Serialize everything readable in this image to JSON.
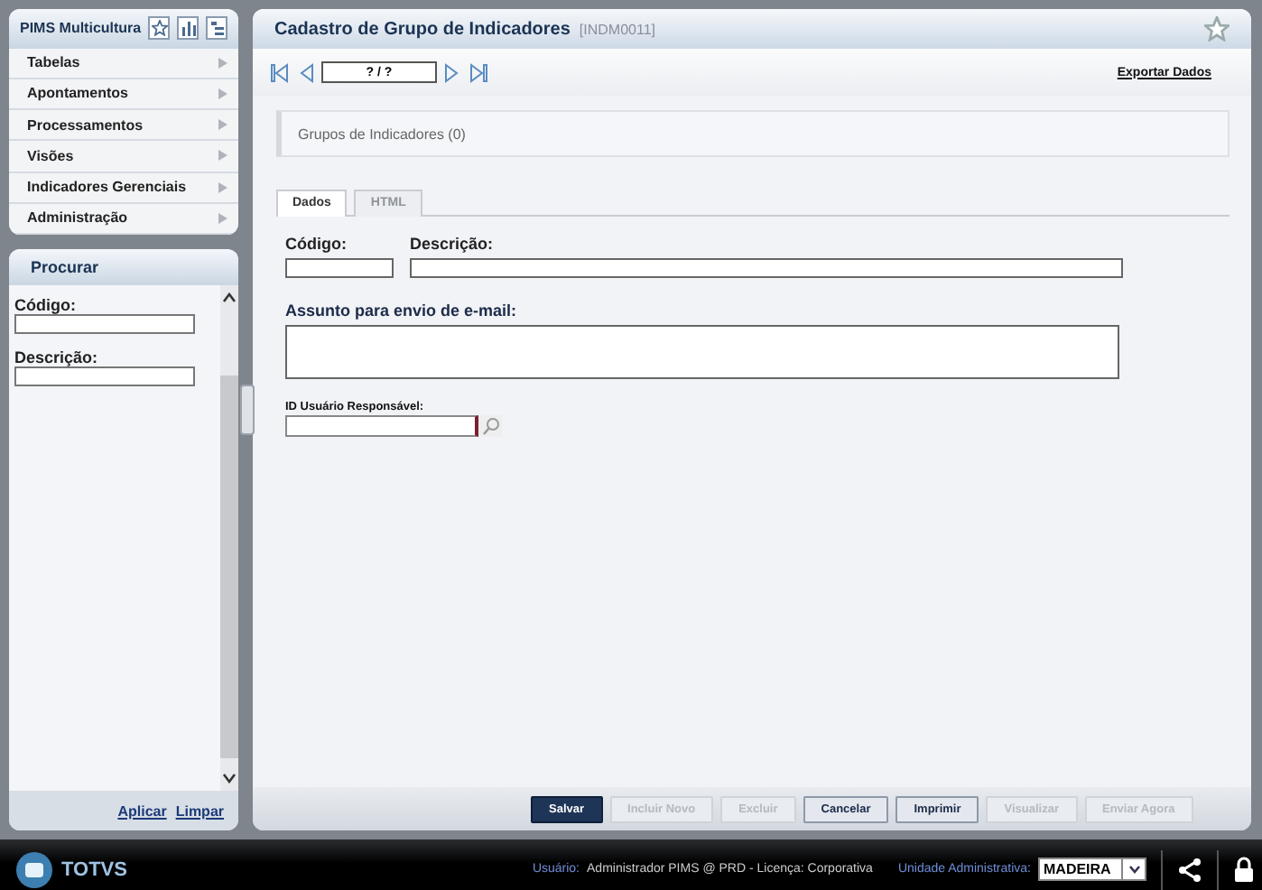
{
  "app_title": "PIMS Multicultura",
  "menu": [
    {
      "label": "Tabelas"
    },
    {
      "label": "Apontamentos"
    },
    {
      "label": "Processamentos"
    },
    {
      "label": "Visões"
    },
    {
      "label": "Indicadores Gerenciais"
    },
    {
      "label": "Administração"
    }
  ],
  "search_panel": {
    "title": "Procurar",
    "fields": [
      {
        "label": "Código:"
      },
      {
        "label": "Descrição:"
      }
    ],
    "links": [
      "Aplicar",
      "Limpar"
    ]
  },
  "window": {
    "title": "Cadastro de Grupo de Indicadores",
    "code": "[INDM0011]"
  },
  "navigator": {
    "position": "? / ?",
    "export_link": "Exportar Dados"
  },
  "group_header": "Grupos de Indicadores (0)",
  "tabs": [
    {
      "label": "Dados",
      "selected": true,
      "disabled": false
    },
    {
      "label": "HTML",
      "selected": false,
      "disabled": true
    }
  ],
  "form": {
    "code_label": "Código:",
    "description_label": "Descrição:",
    "subject_label": "Assunto para envio de e-mail:",
    "user_id_label": "ID Usuário Responsável:"
  },
  "buttons": [
    {
      "label": "Salvar",
      "kind": "primary",
      "disabled": false
    },
    {
      "label": "Incluir Novo",
      "kind": "normal",
      "disabled": true
    },
    {
      "label": "Excluir",
      "kind": "normal",
      "disabled": true
    },
    {
      "label": "Cancelar",
      "kind": "normal",
      "disabled": false
    },
    {
      "label": "Imprimir",
      "kind": "normal",
      "disabled": false
    },
    {
      "label": "Visualizar",
      "kind": "normal",
      "disabled": true
    },
    {
      "label": "Enviar Agora",
      "kind": "normal",
      "disabled": true
    }
  ],
  "status_bar": {
    "brand": "TOTVS",
    "user_label": "Usuário:",
    "user_value": "Administrador PIMS @ PRD - Licença: Corporativa",
    "unit_label": "Unidade Administrativa:",
    "unit_value": "MADEIRA"
  }
}
